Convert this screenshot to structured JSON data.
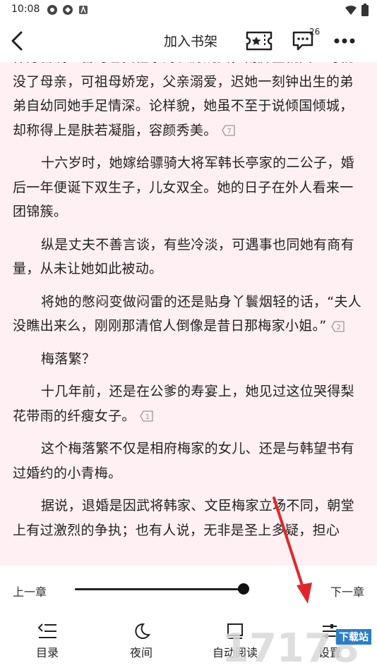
{
  "status_bar": {
    "time": "10:08"
  },
  "top_bar": {
    "add_shelf": "加入书架",
    "comment_count": "26"
  },
  "content": {
    "paragraphs": [
      {
        "text": "仲方普满五音时已贵任家的长房婉女，南屏宝就面上时就没了母亲，可祖母娇宠，父亲溺爱，迟她一刻钟出生的弟弟自幼同她手足情深。论样貌，她虽不至于说倾国倾城，却称得上是肤若凝脂，容颜秀美。",
        "note": "7",
        "indent": false
      },
      {
        "text": "十六岁时，她嫁给骠骑大将军韩长亭家的二公子，婚后一年便诞下双生子，儿女双全。她的日子在外人看来一团锦簇。",
        "note": "",
        "indent": true
      },
      {
        "text": "纵是丈夫不善言谈，有些冷淡，可遇事也同她有商有量，从未让她如此被动。",
        "note": "",
        "indent": true
      },
      {
        "text": "将她的憋闷变做闷雷的还是贴身丫鬟烟轻的话，“夫人没瞧出来么，刚刚那清倌人倒像是昔日那梅家小姐。”",
        "note": "2",
        "indent": true
      },
      {
        "text": "梅落繁？",
        "note": "",
        "indent": true
      },
      {
        "text": "十几年前，还是在公爹的寿宴上，她见过这位哭得梨花带雨的纤瘦女子。",
        "note": "1",
        "indent": true
      },
      {
        "text": "这个梅落繁不仅是相府梅家的女儿、还是与韩望书有过婚约的小青梅。",
        "note": "",
        "indent": true
      },
      {
        "text": "据说，退婚是因武将韩家、文臣梅家立场不同，朝堂上有过激烈的争执；也有人说，无非是圣上多疑，担心",
        "note": "",
        "indent": true
      }
    ]
  },
  "bottom": {
    "prev_chapter": "上一章",
    "next_chapter": "下一章",
    "progress": 0.92,
    "tools": {
      "catalog": "目录",
      "night": "夜间",
      "auto_read": "自动阅读",
      "settings": "设置"
    }
  },
  "watermark": {
    "site_label": "下载站",
    "site_number": "17178"
  },
  "colors": {
    "reading_bg": "#fff0f3",
    "text": "#222222",
    "arrow": "#e0282b"
  }
}
